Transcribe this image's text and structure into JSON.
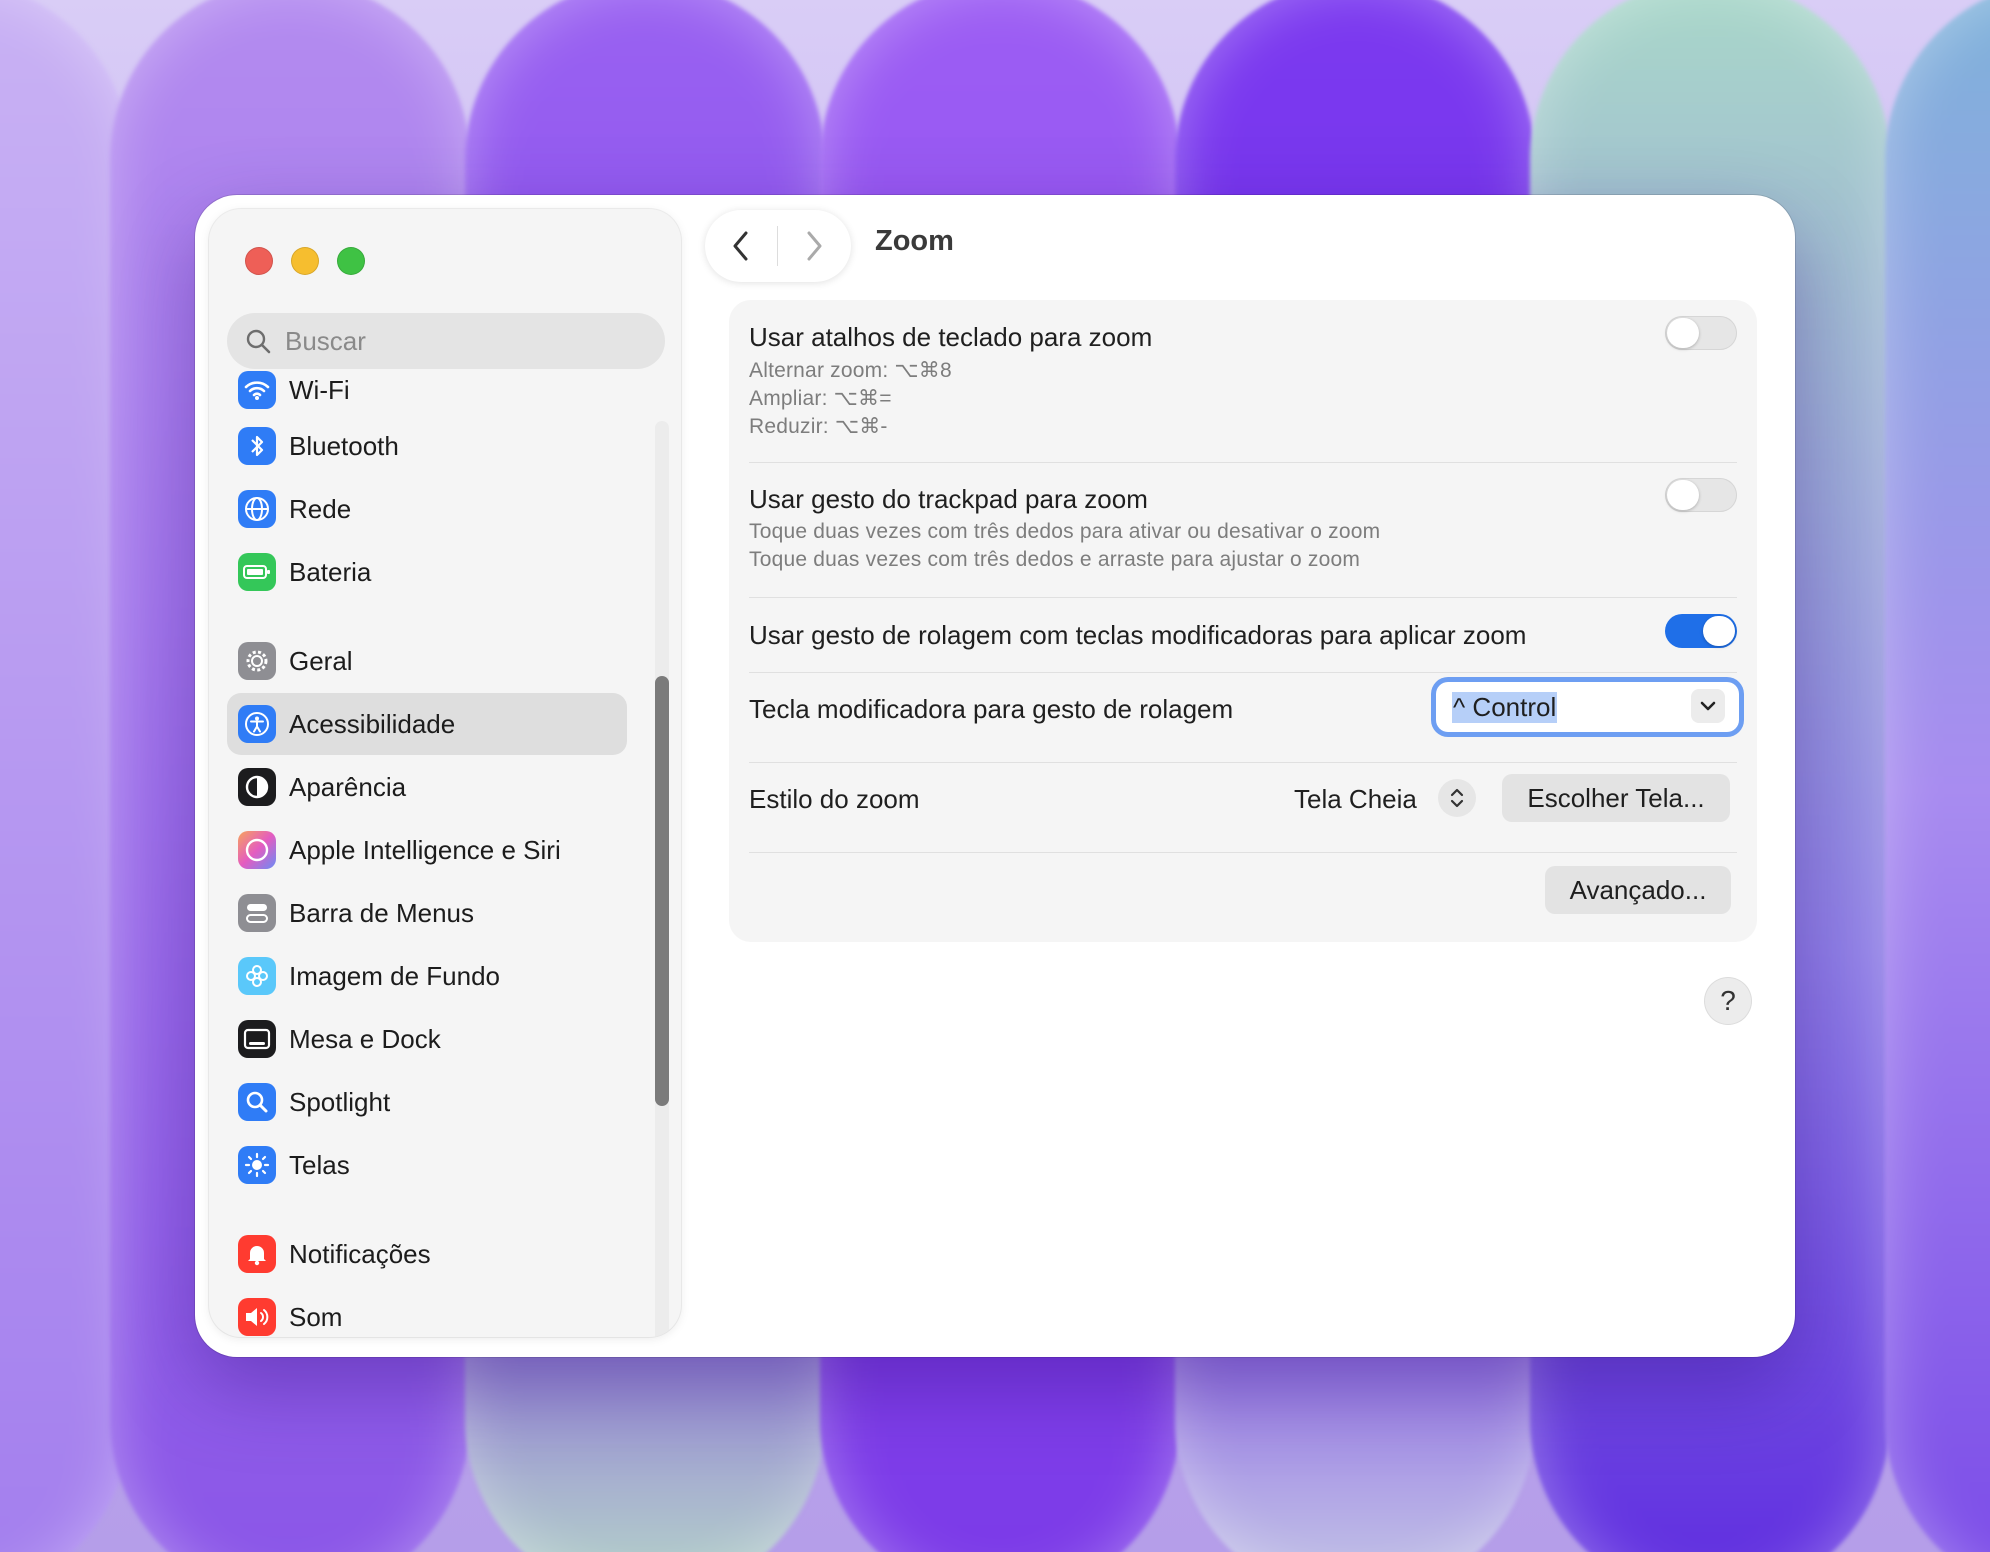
{
  "window": {
    "title": "Zoom",
    "nav": {
      "back_icon": "chevron-left-icon",
      "forward_icon": "chevron-right-icon"
    }
  },
  "sidebar": {
    "search_placeholder": "Buscar",
    "items": [
      {
        "label": "Wi-Fi",
        "icon": "wifi-icon",
        "color": "#2f7cf6"
      },
      {
        "label": "Bluetooth",
        "icon": "bluetooth-icon",
        "color": "#2f7cf6"
      },
      {
        "label": "Rede",
        "icon": "globe-icon",
        "color": "#2f7cf6"
      },
      {
        "label": "Bateria",
        "icon": "battery-icon",
        "color": "#34c759"
      },
      {
        "label": "Geral",
        "icon": "gear-icon",
        "color": "#8e8e93"
      },
      {
        "label": "Acessibilidade",
        "icon": "accessibility-icon",
        "color": "#2f7cf6",
        "selected": true
      },
      {
        "label": "Aparência",
        "icon": "appearance-icon",
        "color": "#1c1c1e"
      },
      {
        "label": "Apple Intelligence e Siri",
        "icon": "siri-icon",
        "color": "#f08a5d"
      },
      {
        "label": "Barra de Menus",
        "icon": "menubar-icon",
        "color": "#8e8e93"
      },
      {
        "label": "Imagem de Fundo",
        "icon": "flower-icon",
        "color": "#5ac8fa"
      },
      {
        "label": "Mesa e Dock",
        "icon": "dock-icon",
        "color": "#1c1c1e"
      },
      {
        "label": "Spotlight",
        "icon": "magnifier-icon",
        "color": "#2f7cf6"
      },
      {
        "label": "Telas",
        "icon": "sun-icon",
        "color": "#2f7cf6"
      },
      {
        "label": "Notificações",
        "icon": "bell-icon",
        "color": "#ff3b30"
      },
      {
        "label": "Som",
        "icon": "speaker-icon",
        "color": "#ff3b30"
      }
    ]
  },
  "zoom": {
    "keyboard": {
      "title": "Usar atalhos de teclado para zoom",
      "lines": [
        "Alternar zoom: ⌥⌘8",
        "Ampliar: ⌥⌘=",
        "Reduzir: ⌥⌘-"
      ],
      "enabled": false
    },
    "trackpad": {
      "title": "Usar gesto do trackpad para zoom",
      "lines": [
        "Toque duas vezes com três dedos para ativar ou desativar o zoom",
        "Toque duas vezes com três dedos e arraste para ajustar o zoom"
      ],
      "enabled": false
    },
    "scroll": {
      "title": "Usar gesto de rolagem com teclas modificadoras para aplicar zoom",
      "enabled": true
    },
    "modifier": {
      "title": "Tecla modificadora para gesto de rolagem",
      "value": "^ Control"
    },
    "style": {
      "title": "Estilo do zoom",
      "value": "Tela Cheia",
      "choose_button": "Escolher Tela..."
    },
    "advanced_button": "Avançado...",
    "help": "?"
  },
  "colors": {
    "accent": "#1f6fe8",
    "focus_ring": "#6d9ef2"
  }
}
